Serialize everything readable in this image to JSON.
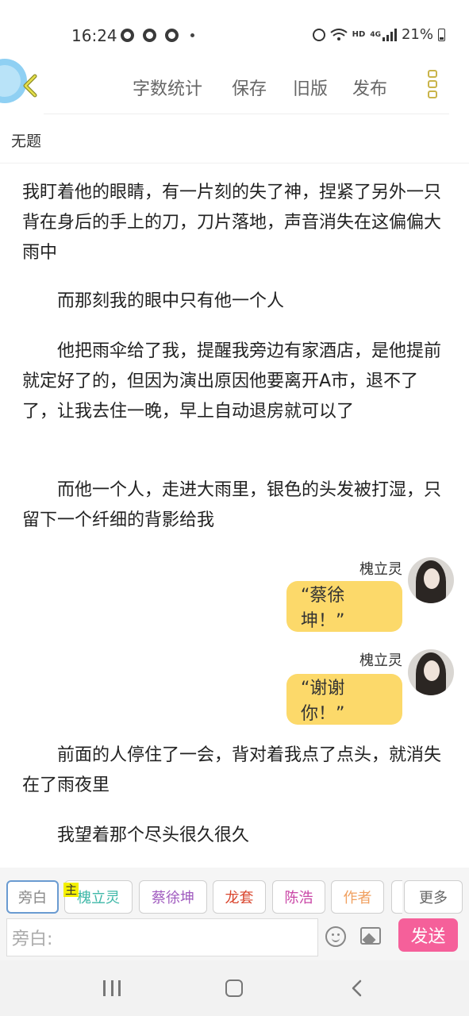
{
  "status_bar": {
    "time": "16:24",
    "network": "HD",
    "signal": "4G",
    "battery": "21%"
  },
  "header": {
    "menu": [
      "字数统计",
      "保存",
      "旧版",
      "发布"
    ]
  },
  "document": {
    "title": "无题",
    "paragraphs": [
      "我盯着他的眼睛，有一片刻的失了神，捏紧了另外一只背在身后的手上的刀，刀片落地，声音消失在这偏偏大雨中",
      "而那刻我的眼中只有他一个人",
      "他把雨伞给了我，提醒我旁边有家酒店，是他提前就定好了的，但因为演出原因他要离开A市，退不了了，让我去住一晚，早上自动退房就可以了",
      "而他一个人，走进大雨里，银色的头发被打湿，只留下一个纤细的背影给我",
      "前面的人停住了一会，背对着我点了点头，就消失在了雨夜里",
      "我望着那个尽头很久很久"
    ],
    "dialogs": [
      {
        "speaker": "槐立灵",
        "text": "“蔡徐坤！”"
      },
      {
        "speaker": "槐立灵",
        "text": "“谢谢你！”"
      }
    ]
  },
  "roles": {
    "host_badge": "主",
    "chips": [
      {
        "label": "旁白",
        "color": "#888888"
      },
      {
        "label": "槐立灵",
        "color": "#3fb8a8"
      },
      {
        "label": "蔡徐坤",
        "color": "#a05bbf"
      },
      {
        "label": "龙套",
        "color": "#d9452d"
      },
      {
        "label": "陈浩",
        "color": "#c946a6"
      },
      {
        "label": "作者",
        "color": "#f0a060"
      }
    ],
    "more": "更多"
  },
  "composer": {
    "placeholder": "旁白:",
    "send": "发送"
  }
}
